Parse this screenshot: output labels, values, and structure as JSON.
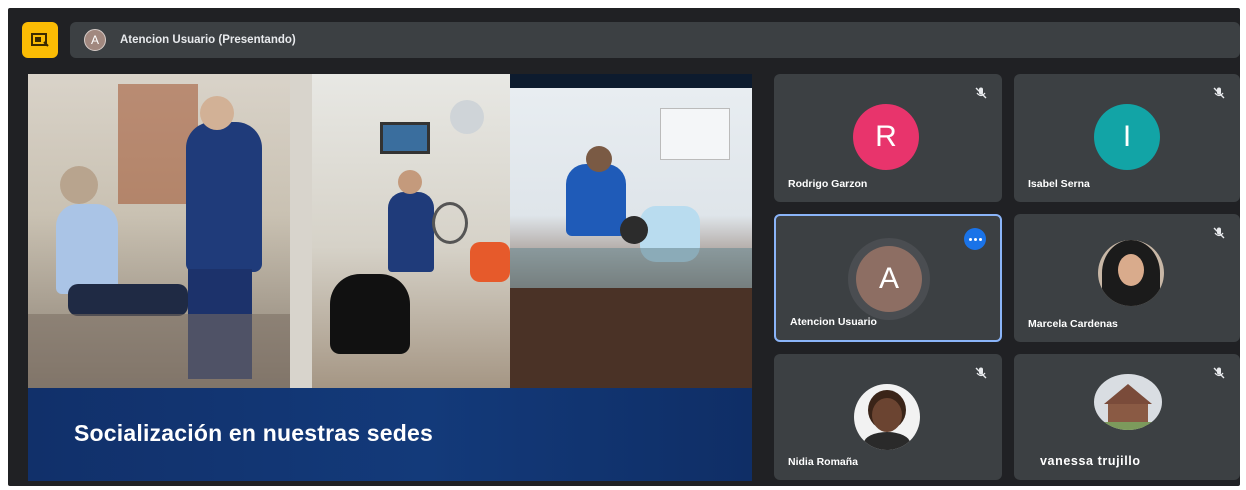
{
  "meeting": {
    "presenter_initial": "A",
    "presenting_label": "Atencion Usuario (Presentando)"
  },
  "presentation": {
    "caption": "Socialización en nuestras sedes"
  },
  "participants": [
    {
      "name": "Rodrigo Garzon",
      "initial": "R",
      "avatar_color": "#e8346c",
      "muted": true
    },
    {
      "name": "Isabel Serna",
      "initial": "I",
      "avatar_color": "#12a4a6",
      "muted": true
    },
    {
      "name": "Atencion Usuario",
      "initial": "A",
      "avatar_color": "#8d6e63",
      "muted": false,
      "speaking": true
    },
    {
      "name": "Marcela Cardenas",
      "muted": true
    },
    {
      "name": "Nidia Romaña",
      "muted": true
    },
    {
      "name": "vanessa trujillo",
      "muted": true
    }
  ],
  "colors": {
    "logo": "#fbbc04",
    "active_border": "#8ab4f8",
    "more_button": "#1a73e8"
  }
}
